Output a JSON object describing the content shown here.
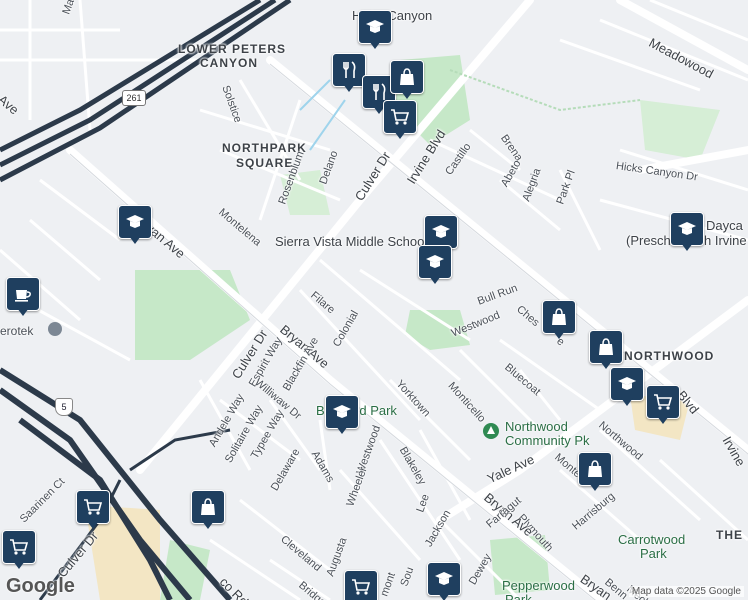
{
  "map": {
    "areas": {
      "lower_peters_canyon": "LOWER PETERS",
      "lower_peters_canyon_2": "CANYON",
      "northpark_square": "NORTHPARK",
      "northpark_square_2": "SQUARE",
      "northwood": "NORTHWOOD",
      "the": "THE"
    },
    "streets": {
      "marketplace": "Marketp",
      "meadowood": "Meadowood",
      "hicks_canyon": "Hicks Canyon Dr",
      "solstice": "Solstice",
      "brena": "Brena",
      "castillo": "Castillo",
      "abeto": "Abeto",
      "alegria": "Alegria",
      "park_pl": "Park Pl",
      "delano": "Delano",
      "rosenblum": "Rosenblum",
      "culver_dr_n": "Culver Dr",
      "irvine_blvd": "Irvine Blvd",
      "montelena": "Montelena",
      "bryan_ave_w": "Bryan Ave",
      "ave_left": "Ave",
      "filare": "Filare",
      "colonial": "Colonial",
      "bull_run": "Bull Run",
      "chesapeake": "Ches",
      "chesapeake_2": "e",
      "westwood": "Westwood",
      "bluecoat": "Bluecoat",
      "culver_dr_mid": "Culver Dr",
      "espirit": "Espirit Way",
      "bryan_ave_mid": "Bryan Ave",
      "blackfin": "Blackfin Ave",
      "yorktown": "Yorktown",
      "monticello": "Monticello",
      "williwaw": "Williwaw Dr",
      "andele": "Andele Way",
      "solitaire": "Solitaire Way",
      "typee": "Typee Way",
      "delaware": "Delaware",
      "adams": "Adams",
      "westwood_2": "Westwood",
      "wheeler": "Wheeler",
      "blakeley": "Blakeley",
      "yale": "Yale Ave",
      "northwood_st": "Northwood",
      "montecito": "Monte",
      "harrisburg": "Harrisburg",
      "plymouth": "Plymouth",
      "bryan_ave_se": "Bryan Ave",
      "farragut": "Farragut",
      "lee": "Lee",
      "jackson": "Jackson",
      "dewey": "Dewey",
      "cleveland": "Cleveland",
      "augusta": "Augusta",
      "bridge": "Bridge",
      "so": "Sou",
      "mont": "mont",
      "culver_dr_sw": "Culver Dr",
      "saarinen": "Saarinen Ct",
      "co_rd": "co Rd",
      "bryan_se2": "Bryan",
      "benn": "Benn",
      "meck": "Meck",
      "irvine_blvd_e": "Irvine",
      "blvd_e": "Blvd",
      "i5_shield": "5",
      "hwy_261": "261"
    },
    "pois": {
      "sierra_vista": "Sierra Vista Middle School",
      "hicks_canyon_school": "Hicks Canyon",
      "hicks_canyon_school_2": "h",
      "bryant_park": "Brywood Park",
      "northwood_park": "Northwood",
      "northwood_park_2": "Community Pk",
      "carrotwood": "Carrotwood",
      "carrotwood_2": "Park",
      "pepperwood": "Pepperwood",
      "pepperwood_2": "Park",
      "daycare": "Dayca",
      "daycare_2": "(Presch",
      "daycare_3": "h Irvine",
      "verotek": "erotek"
    },
    "pin_icons": [
      "school-icon",
      "restaurant-icon",
      "shopping-bag-icon",
      "shopping-cart-icon",
      "coffee-icon"
    ],
    "attribution": "Map data ©2025 Google",
    "logo": "Google",
    "colors": {
      "land": "#eef0f3",
      "road": "#ffffff",
      "highway": "#2c3a4a",
      "park": "#c6e8c8",
      "commercial": "#f3e6c4",
      "pin": "#1f3f5f",
      "water": "#9fd4ec"
    }
  }
}
